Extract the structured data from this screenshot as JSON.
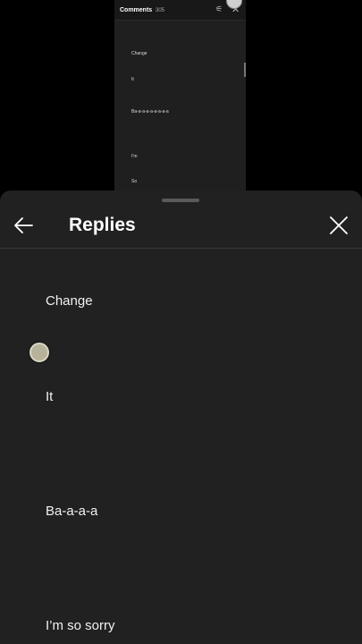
{
  "background_screen": {
    "title": "Comments",
    "count": "305",
    "lines": [
      "Change",
      "It",
      "Ba-a-a-a-a-a-a-a-a",
      "I'm",
      "So"
    ]
  },
  "sheet": {
    "title": "Replies",
    "replies": [
      "Change",
      "It",
      "Ba-a-a-a",
      "I’m so sorry"
    ]
  },
  "colors": {
    "sheet_background": "#212121",
    "text": "#f1f1f1",
    "page_background": "#000000"
  },
  "icons": {
    "back": "arrow-left-icon",
    "close": "close-icon",
    "filter": "filter-icon"
  }
}
